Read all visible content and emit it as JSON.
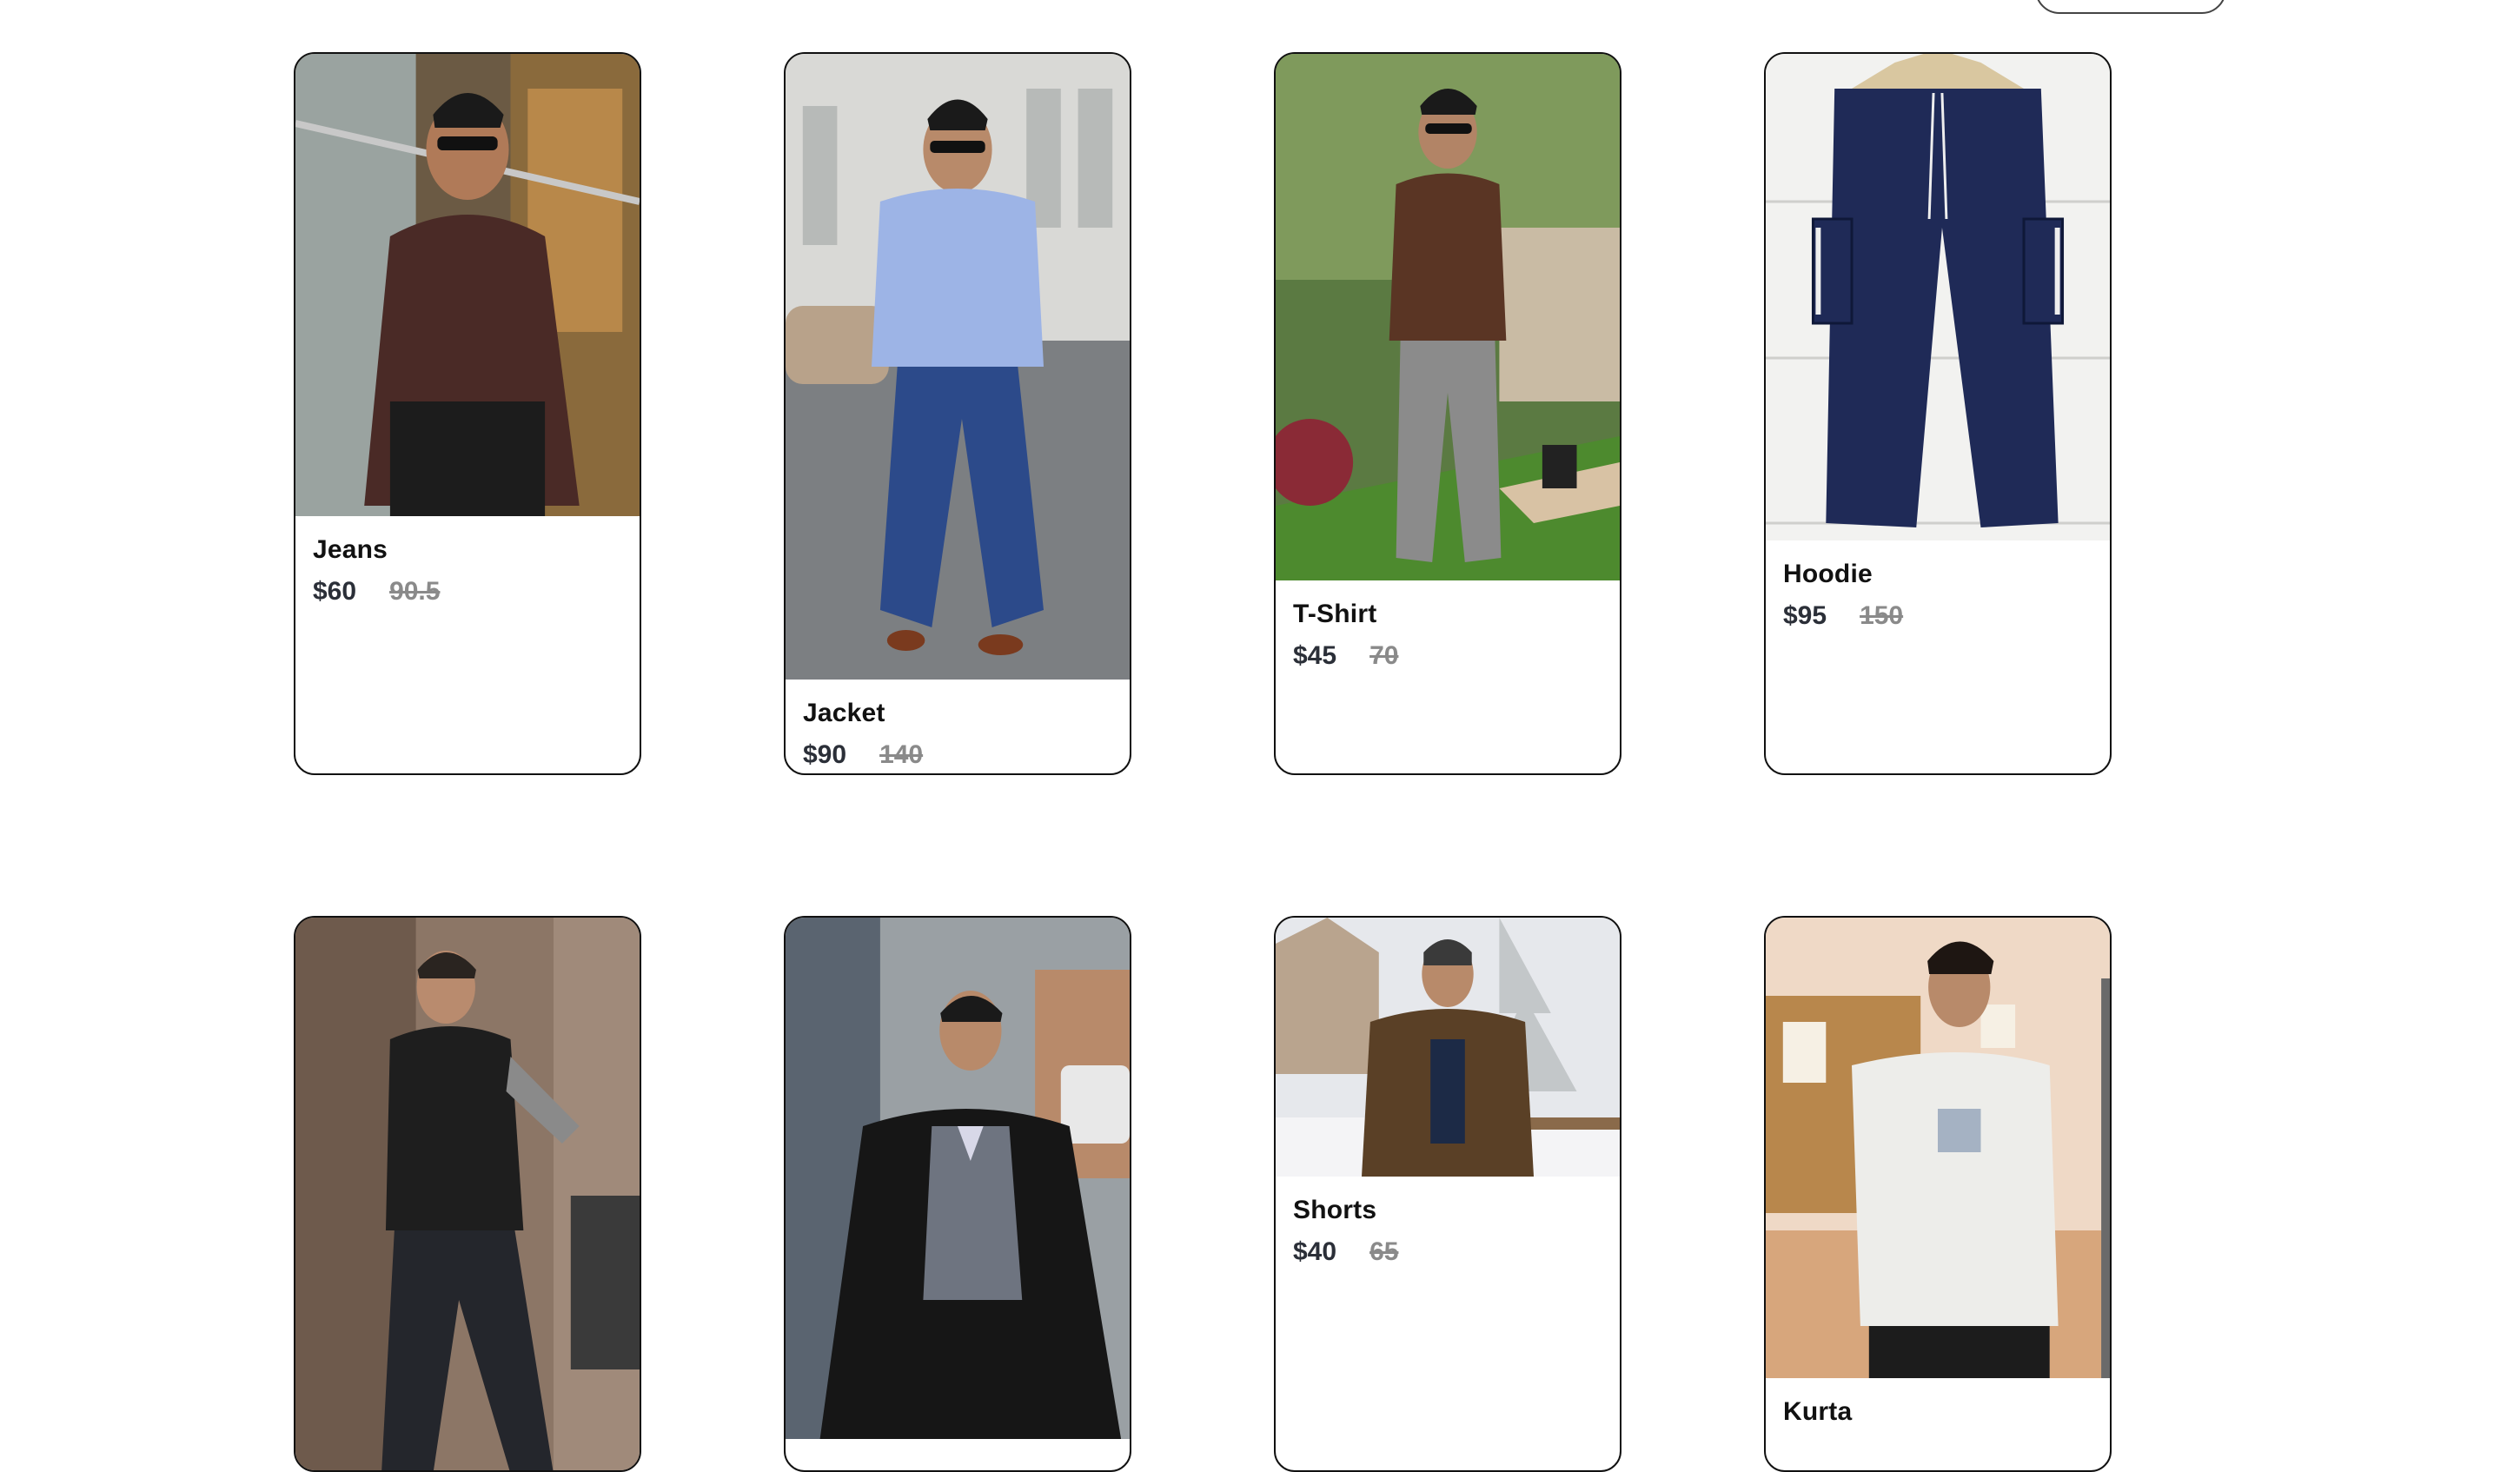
{
  "products": [
    {
      "name": "Jeans",
      "price": "$60",
      "original_price": "90.5",
      "image": "man-brown-shirt-photo"
    },
    {
      "name": "Jacket",
      "price": "$90",
      "original_price": "140",
      "image": "man-blue-suit-photo"
    },
    {
      "name": "T-Shirt",
      "price": "$45",
      "original_price": "70",
      "image": "man-cargo-pants-garden-photo"
    },
    {
      "name": "Hoodie",
      "price": "$95",
      "original_price": "150",
      "image": "navy-cargo-pants-photo"
    },
    {
      "name": "",
      "price": "",
      "original_price": "",
      "image": "man-puffer-vest-photo"
    },
    {
      "name": "",
      "price": "",
      "original_price": "",
      "image": "man-black-coat-photo"
    },
    {
      "name": "Shorts",
      "price": "$40",
      "original_price": "65",
      "image": "man-parka-snow-photo"
    },
    {
      "name": "Kurta",
      "price": "",
      "original_price": "",
      "image": "man-white-tee-photo"
    }
  ],
  "colors": {
    "card_border": "#111111",
    "price": "#2b2f38",
    "original_price": "#8a8a8a"
  }
}
